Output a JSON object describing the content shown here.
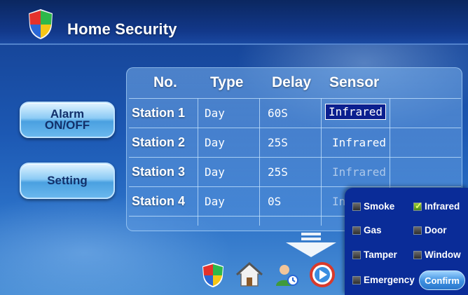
{
  "app": {
    "title": "Home Security",
    "logo_icon": "shield-logo-icon"
  },
  "sidebar": {
    "alarm_label": "Alarm ON/OFF",
    "setting_label": "Setting"
  },
  "table": {
    "headers": [
      "No.",
      "Type",
      "Delay",
      "Sensor"
    ],
    "rows": [
      {
        "station": "Station 1",
        "type": "Day",
        "delay": "60S",
        "sensor": "Infrared"
      },
      {
        "station": "Station 2",
        "type": "Day",
        "delay": "25S",
        "sensor": "Infrared"
      },
      {
        "station": "Station 3",
        "type": "Day",
        "delay": "25S",
        "sensor": "Infrared"
      },
      {
        "station": "Station 4",
        "type": "Day",
        "delay": "0S",
        "sensor": "In"
      }
    ]
  },
  "sensor_popup": {
    "options": [
      {
        "label": "Smoke",
        "checked": false
      },
      {
        "label": "Infrared",
        "checked": true
      },
      {
        "label": "Gas",
        "checked": false
      },
      {
        "label": "Door",
        "checked": false
      },
      {
        "label": "Tamper",
        "checked": false
      },
      {
        "label": "Window",
        "checked": false
      },
      {
        "label": "Emergency",
        "checked": false
      }
    ],
    "confirm_label": "Confirm"
  },
  "dock": {
    "icons": [
      "shield-icon",
      "home-icon",
      "user-icon",
      "play-icon"
    ]
  },
  "colors": {
    "accent": "#1c58b3",
    "selection": "#0b1f8f",
    "popup": "#0a2c98"
  }
}
